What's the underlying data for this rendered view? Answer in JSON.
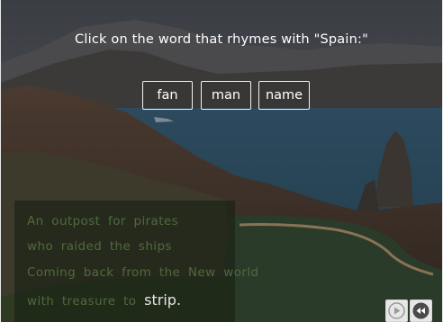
{
  "prompt": "Click on the word that rhymes with \"Spain:\"",
  "choices": [
    "fan",
    "man",
    "name"
  ],
  "poem": {
    "line1": "An outpost for pirates",
    "line2": "who raided the ships",
    "line3": "Coming back from the New world",
    "line4_text": "with treasure to ",
    "line4_word": "strip."
  },
  "controls": {
    "play_icon": "play-icon",
    "rewind_icon": "rewind-icon"
  },
  "colors": {
    "poem_text": "#4f6a3c",
    "highlight_word": "#e6e6e6",
    "choice_border": "#f2f2f2"
  }
}
